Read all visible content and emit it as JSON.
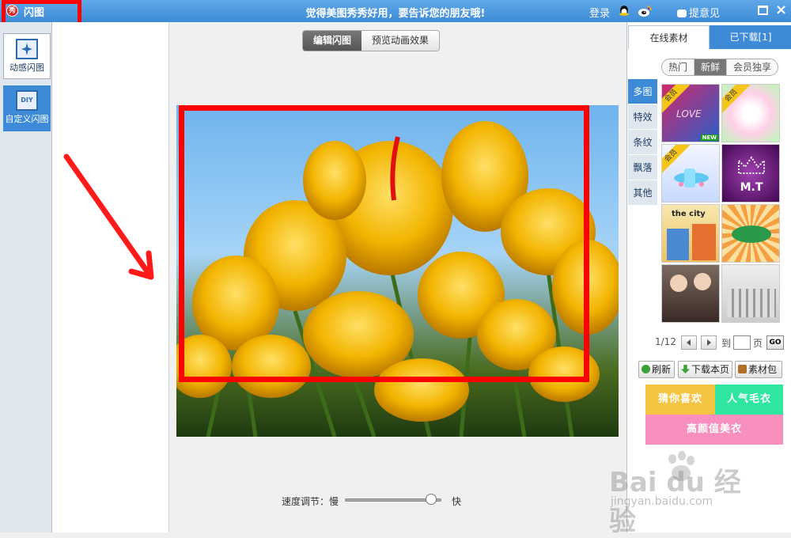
{
  "titlebar": {
    "app_icon_text": "秀",
    "title": "闪图",
    "slogan": "觉得美图秀秀好用，要告诉您的朋友哦!",
    "login": "登录",
    "feedback": "提意见"
  },
  "sidebar": {
    "items": [
      {
        "label": "动感闪图",
        "icon": "sparkle-icon"
      },
      {
        "label": "自定义闪图",
        "icon_text": "DIY",
        "icon": "diy-icon"
      }
    ]
  },
  "main": {
    "tabs": [
      {
        "label": "编辑闪图",
        "active": true
      },
      {
        "label": "预览动画效果",
        "active": false
      }
    ],
    "speed_label": "速度调节：慢",
    "fast_label": "快",
    "speed_value": 0.88
  },
  "right": {
    "tabs": [
      {
        "label": "在线素材",
        "active": true
      },
      {
        "label": "已下载[1]",
        "active": false
      }
    ],
    "filters": [
      {
        "label": "热门",
        "active": false
      },
      {
        "label": "新鲜",
        "active": true
      },
      {
        "label": "会员独享",
        "active": false
      }
    ],
    "categories": [
      {
        "label": "多图",
        "active": true
      },
      {
        "label": "特效",
        "active": false
      },
      {
        "label": "条纹",
        "active": false
      },
      {
        "label": "飘落",
        "active": false
      },
      {
        "label": "其他",
        "active": false
      }
    ],
    "thumbs": [
      {
        "vip": "会员",
        "tag": "NEW",
        "text": "LOVE"
      },
      {
        "vip": "会员"
      },
      {
        "vip": "会员"
      },
      {
        "text": "M.T"
      },
      {
        "text": "the city"
      },
      {},
      {},
      {}
    ],
    "pager": {
      "current": "1/12",
      "goto": "到",
      "page": "页",
      "go": "GO"
    },
    "actions": [
      {
        "label": "刷新",
        "icon": "refresh-icon",
        "color": "#3aa03a"
      },
      {
        "label": "下载本页",
        "icon": "download-icon",
        "color": "#3aa03a"
      },
      {
        "label": "素材包",
        "icon": "package-icon",
        "color": "#b0702a"
      }
    ],
    "promos": [
      {
        "label": "猜你喜欢",
        "color": "#f5c542"
      },
      {
        "label": "人气毛衣",
        "color": "#2ee6a0"
      },
      {
        "label": "高颜值美衣",
        "color": "#f78fbf"
      }
    ]
  },
  "watermark": {
    "main": "Bai du 经验",
    "sub": "jingyan.baidu.com"
  }
}
